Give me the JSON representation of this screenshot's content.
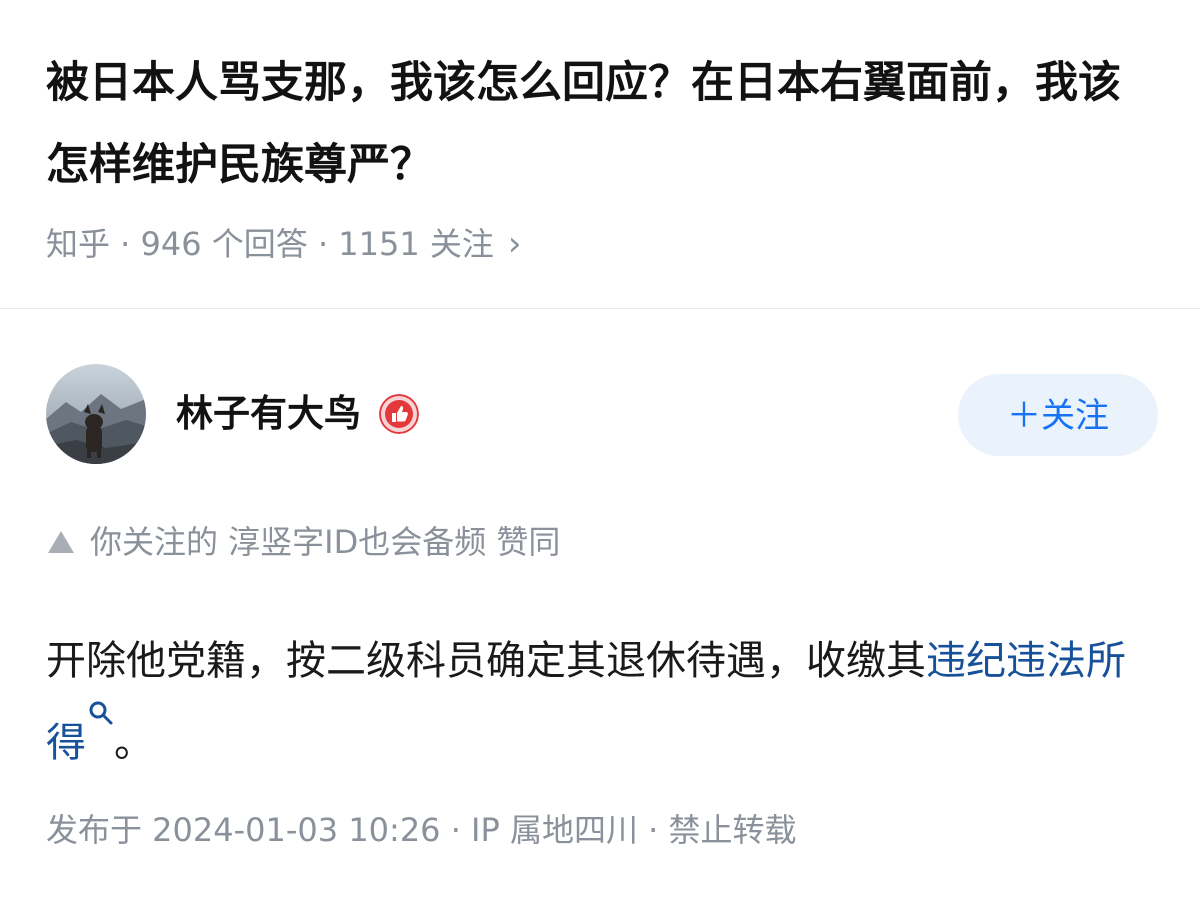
{
  "question": {
    "title": "被日本人骂支那，我该怎么回应？在日本右翼面前，我该怎样维护民族尊严？",
    "meta": "知乎 · 946 个回答 · 1151 关注",
    "chevron": "›"
  },
  "answer": {
    "author_name": "林子有大鸟",
    "avatar_icon": "dog-avatar",
    "badge_icon": "thumbs-up-badge-icon",
    "follow_label": "＋关注",
    "upvote_line": "你关注的 淳竖字ID也会备频 赞同",
    "content_text": "开除他党籍，按二级科员确定其退休待遇，收缴其",
    "content_link": "违纪违法所得",
    "content_end": "。",
    "publish_info": "发布于 2024-01-03 10:26 · IP 属地四川 · 禁止转载"
  },
  "colors": {
    "accent": "#1772f6",
    "link": "#175199",
    "meta": "#8a919b",
    "badge": "#e4393c"
  }
}
